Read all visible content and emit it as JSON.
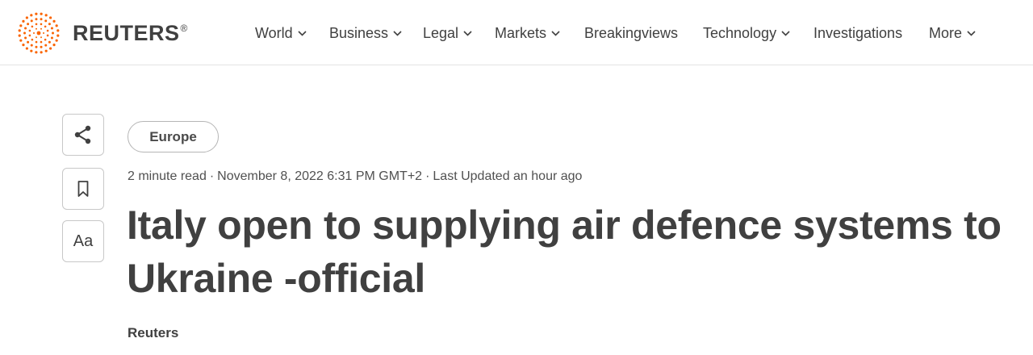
{
  "brand": {
    "name": "REUTERS",
    "reg_mark": "®",
    "accent_color": "#fa6400"
  },
  "nav": {
    "items": [
      {
        "label": "World",
        "has_dropdown": true
      },
      {
        "label": "Business",
        "has_dropdown": true
      },
      {
        "label": "Legal",
        "has_dropdown": true
      },
      {
        "label": "Markets",
        "has_dropdown": true
      },
      {
        "label": "Breakingviews",
        "has_dropdown": false
      },
      {
        "label": "Technology",
        "has_dropdown": true
      },
      {
        "label": "Investigations",
        "has_dropdown": false
      },
      {
        "label": "More",
        "has_dropdown": true
      }
    ]
  },
  "sidebar": {
    "share_icon": "share-icon",
    "bookmark_icon": "bookmark-icon",
    "text_size_label": "Aa"
  },
  "article": {
    "category": "Europe",
    "read_time": "2 minute read",
    "published": "November 8, 2022 6:31 PM GMT+2",
    "updated": "Last Updated an hour ago",
    "title": "Italy open to supplying air defence systems to Ukraine -official",
    "byline": "Reuters"
  }
}
